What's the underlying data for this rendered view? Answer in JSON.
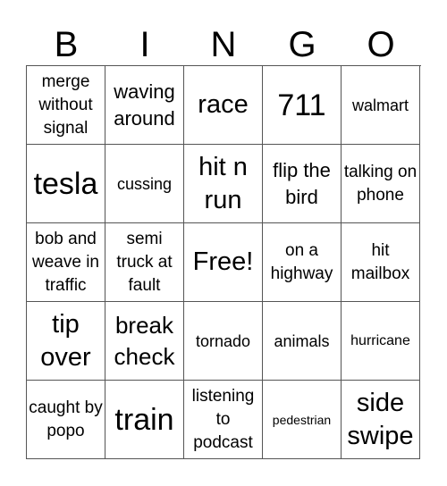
{
  "header": {
    "letters": [
      "B",
      "I",
      "N",
      "G",
      "O"
    ]
  },
  "cells": [
    "merge without signal",
    "waving around",
    "race",
    "711",
    "walmart",
    "tesla",
    "cussing",
    "hit n run",
    "flip the bird",
    "talking on phone",
    "bob and weave in traffic",
    "semi truck at fault",
    "Free!",
    "on a highway",
    "hit mailbox",
    "tip over",
    "break check",
    "tornado",
    "animals",
    "hurricane",
    "caught by popo",
    "train",
    "listening to podcast",
    "pedestrian",
    "side swipe"
  ]
}
